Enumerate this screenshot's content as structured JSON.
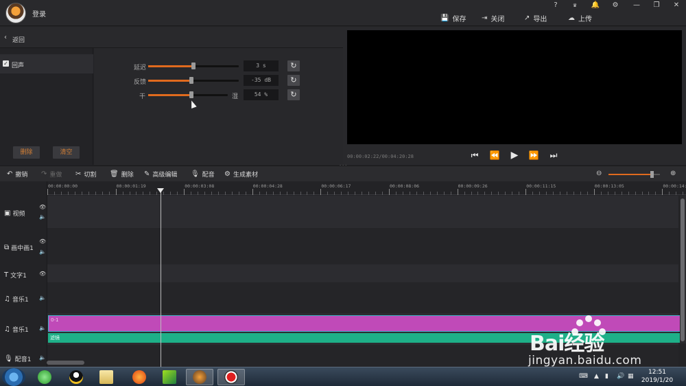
{
  "titlebar": {
    "login": "登录",
    "save": "保存",
    "close": "关闭",
    "export": "导出",
    "upload": "上传",
    "help": "?",
    "vip": "VIP"
  },
  "left": {
    "back": "返回",
    "effect": "回声",
    "delete": "删除",
    "clear": "清空"
  },
  "params": {
    "delay_label": "延迟",
    "delay_value": "3 s",
    "delay_level": 0.5,
    "feedback_label": "反馈",
    "feedback_value": "-35 dB",
    "feedback_level": 0.48,
    "dry_label": "干",
    "wet_label": "湿",
    "drywet_value": "54 %",
    "drywet_level": 0.54
  },
  "preview": {
    "timecode": "00:00:02:22/00:04:20:28"
  },
  "toolbar": {
    "undo": "撤销",
    "redo": "重做",
    "split": "切割",
    "delete": "删除",
    "advanced": "高级编辑",
    "dub": "配音",
    "generate": "生成素材",
    "zoom_level": 0.85
  },
  "ruler": {
    "ticks": [
      "00:00:00:00",
      "00:00:01:19",
      "00:00:03:08",
      "00:00:04:28",
      "00:00:06:17",
      "00:00:08:06",
      "00:00:09:26",
      "00:00:11:15",
      "00:00:13:05",
      "00:00:14:"
    ]
  },
  "tracks": {
    "video": "视频",
    "pip": "画中画1",
    "text": "文字1",
    "music1": "音乐1",
    "music2": "音乐1",
    "dub": "配音1"
  },
  "clips": {
    "video_clip": "0-1",
    "filter_clip": "滤镜"
  },
  "taskbar": {
    "time": "12:51",
    "date": "2019/1/20"
  },
  "watermark": {
    "logo": "Bai经验",
    "url": "jingyan.baidu.com"
  },
  "colors": {
    "accent": "#e06a1e",
    "clip": "#c04ab8",
    "filter": "#1eb088"
  }
}
